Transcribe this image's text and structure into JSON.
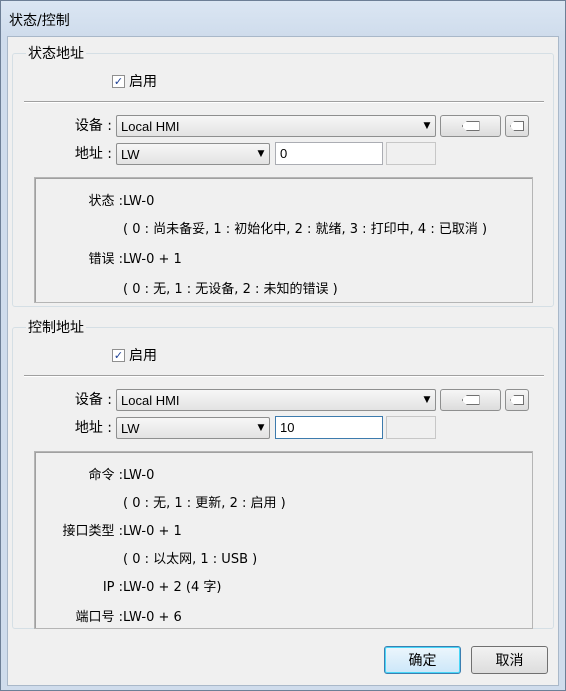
{
  "window": {
    "title": "状态/控制"
  },
  "status_section": {
    "title": "状态地址",
    "enable_label": "启用",
    "enable_checked": true,
    "device_label": "设备 :",
    "device_value": "Local HMI",
    "address_label": "地址 :",
    "address_type": "LW",
    "address_value": "0",
    "rows": [
      {
        "key": "状态 :",
        "value": "LW-0"
      },
      {
        "key": "",
        "value": "( 0 : 尚未备妥, 1 : 初始化中, 2 : 就绪, 3 : 打印中, 4 : 已取消 )"
      },
      {
        "key": "错误 :",
        "value": "LW-0 + 1"
      },
      {
        "key": "",
        "value": "( 0 : 无, 1 : 无设备, 2 : 未知的错误 )"
      }
    ]
  },
  "control_section": {
    "title": "控制地址",
    "enable_label": "启用",
    "enable_checked": true,
    "device_label": "设备 :",
    "device_value": "Local HMI",
    "address_label": "地址 :",
    "address_type": "LW",
    "address_value": "10",
    "rows": [
      {
        "key": "命令 :",
        "value": "LW-0"
      },
      {
        "key": "",
        "value": "( 0 : 无, 1 : 更新, 2 : 启用 )"
      },
      {
        "key": "接口类型 :",
        "value": "LW-0 + 1"
      },
      {
        "key": "",
        "value": "( 0 : 以太网, 1 : USB )"
      },
      {
        "key": "IP :",
        "value": "LW-0 + 2 (4 字)"
      },
      {
        "key": "端口号 :",
        "value": "LW-0 + 6"
      }
    ]
  },
  "buttons": {
    "ok": "确定",
    "cancel": "取消"
  },
  "icons": {
    "tag_icon": "tag-setting-icon",
    "tag_add_icon": "tag-add-icon",
    "dropdown": "chevron-down-icon",
    "check": "checkmark-icon"
  }
}
